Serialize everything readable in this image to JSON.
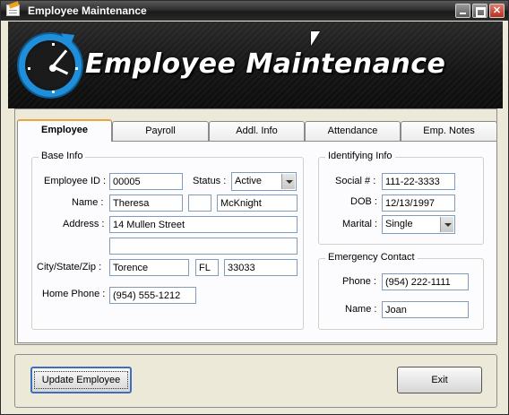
{
  "window": {
    "title": "Employee Maintenance"
  },
  "banner": {
    "title": "Employee Maintenance",
    "logo_icon": "clock-icon",
    "accent_color": "#1e8fd8"
  },
  "tabs": [
    {
      "label": "Employee",
      "active": true
    },
    {
      "label": "Payroll",
      "active": false
    },
    {
      "label": "Addl. Info",
      "active": false
    },
    {
      "label": "Attendance",
      "active": false
    },
    {
      "label": "Emp. Notes",
      "active": false
    }
  ],
  "base_info": {
    "legend": "Base Info",
    "employee_id_label": "Employee ID :",
    "employee_id": "00005",
    "status_label": "Status :",
    "status": "Active",
    "name_label": "Name :",
    "first_name": "Theresa",
    "middle_initial": "",
    "last_name": "McKnight",
    "address_label": "Address :",
    "address1": "14 Mullen Street",
    "address2": "",
    "csz_label": "City/State/Zip :",
    "city": "Torence",
    "state": "FL",
    "zip": "33033",
    "home_phone_label": "Home Phone :",
    "home_phone": "(954) 555-1212"
  },
  "identifying_info": {
    "legend": "Identifying Info",
    "ssn_label": "Social # :",
    "ssn": "111-22-3333",
    "dob_label": "DOB :",
    "dob": "12/13/1997",
    "marital_label": "Marital :",
    "marital": "Single"
  },
  "emergency_contact": {
    "legend": "Emergency Contact",
    "phone_label": "Phone :",
    "phone": "(954) 222-1111",
    "name_label": "Name :",
    "name": "Joan"
  },
  "actions": {
    "update_label": "Update Employee",
    "exit_label": "Exit"
  }
}
